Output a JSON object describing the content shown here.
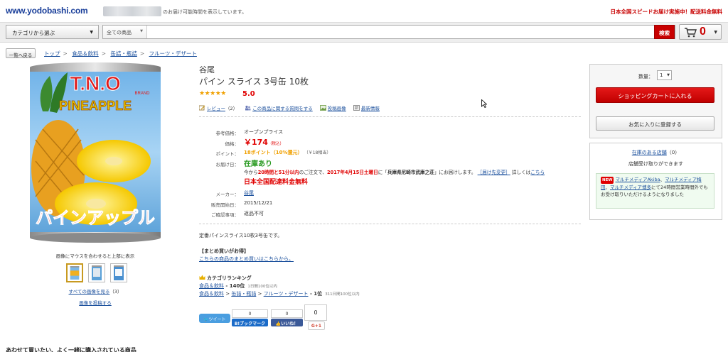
{
  "header": {
    "logo_text": "www.yodobashi.com",
    "delivery_text": "のお届け可能時間を表示しています。",
    "promo_text": "日本全国スピードお届け実施中！配送料金無料"
  },
  "search": {
    "category_label": "カテゴリから選ぶ",
    "scope_label": "全ての商品",
    "query": "",
    "button_label": "検索",
    "cart_count": "0"
  },
  "nav": {
    "back_label": "一覧へ戻る",
    "breadcrumb": [
      "トップ",
      "食品＆飲料",
      "缶詰・瓶詰",
      "フルーツ・デザート"
    ]
  },
  "gallery": {
    "caption": "画像にマウスを合わせると上部に表示",
    "all_images_label": "すべての画像を見る",
    "all_images_count": "（3）",
    "post_image_label": "画像を投稿する",
    "can_brand": "T.N.O",
    "can_small": "BRAND",
    "can_title": "PINEAPPLE",
    "can_jp": "パインアップル"
  },
  "product": {
    "brand": "谷尾",
    "name": "パイン スライス 3号缶 10枚",
    "stars": "★★★★★",
    "rating": "5.0",
    "links": {
      "review": "レビュー",
      "review_count": "（2）",
      "qa": "この商品に関する質問をする",
      "post_image": "投稿画像",
      "latest": "最新情報"
    },
    "specs": {
      "ref_price_label": "参考価格：",
      "ref_price": "オープンプライス",
      "price_label": "価格：",
      "price": "￥174",
      "tax": "（税込）",
      "points_label": "ポイント：",
      "points": "18ポイント（10%還元）",
      "points_yen": "（￥18相当）",
      "delivery_label": "お届け日：",
      "stock": "在庫あり",
      "delivery_1": "今から",
      "delivery_time": "20時間と51分以内",
      "delivery_2": "のご注文で、",
      "delivery_date": "2017年4月15日土曜日",
      "delivery_3": "に「",
      "delivery_place": "兵庫県尼崎市武庫之荘",
      "delivery_4": "」にお届けします。",
      "delivery_change": "［届け先変更］",
      "delivery_5": "詳しくは",
      "delivery_here": "こちら",
      "free_ship": "日本全国配達料金無料",
      "maker_label": "メーカー：",
      "maker": "谷尾",
      "release_label": "販売開始日：",
      "release": "2015/12/21",
      "notes_label": "ご確認事項：",
      "notes": "返品不可"
    },
    "description": "定番パインスライス10枚3号缶です。",
    "bulk_title": "【まとめ買いがお得】",
    "bulk_link": "こちらの商品のまとめ買いはこちらから。",
    "ranking": {
      "title": "カテゴリランキング",
      "r1_cat": "食品＆飲料",
      "r1_rank": " - 140位",
      "r1_note": "1日間100位以内",
      "r2_cat1": "食品＆飲料",
      "r2_cat2": "缶詰・瓶詰",
      "r2_cat3": "フルーツ・デザート",
      "r2_rank": " - 1位",
      "r2_note": "311日間100位以内"
    }
  },
  "social": {
    "tweet": "ツイート",
    "hatena_count": "0",
    "hatena": "B!ブックマーク",
    "fb_count": "0",
    "fb": "いいね！",
    "gplus_count": "0",
    "gplus": "G+1"
  },
  "sidebar": {
    "qty_label": "数量：",
    "qty_value": "1",
    "cart_button": "ショッピングカートに入れる",
    "fav_button": "お気に入りに登録する",
    "store_title": "在庫のある店舗",
    "store_count": "（0）",
    "store_sub": "店舗受け取りができます",
    "new_badge": "NEW",
    "store_link1": "マルチメディアAkiba",
    "store_sep": "、",
    "store_link2": "マルチメディア梅田",
    "store_link3": "マルチメディア博多",
    "store_text": "にて24時間営業時間外でもお受け取りいただけるようになりました"
  },
  "bottom": {
    "heading": "あわせて買いたい、よく一緒に購入されている商品"
  },
  "colors": {
    "accent_red": "#c80000",
    "price_red": "#e00000",
    "stock_green": "#2a9a22",
    "link_blue": "#1a4f9c"
  }
}
